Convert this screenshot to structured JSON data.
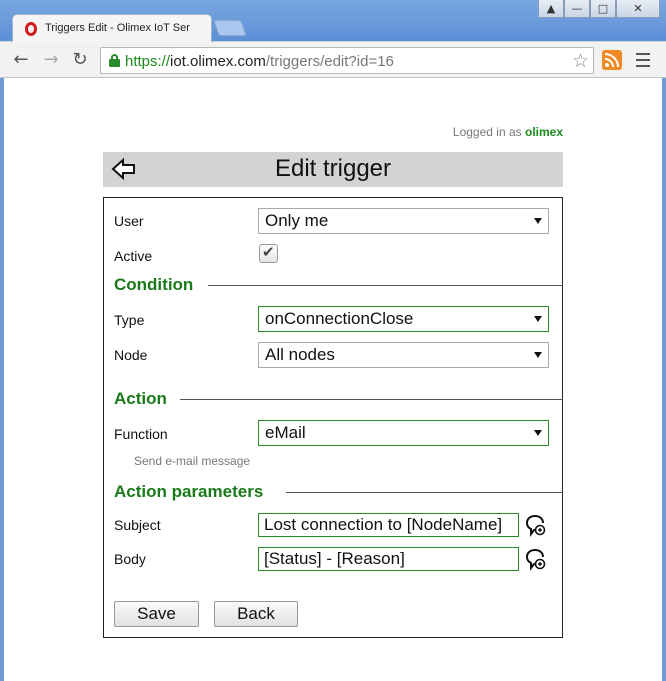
{
  "browser": {
    "tab_title": "Triggers Edit - Olimex IoT Ser",
    "window_buttons": [
      "▲",
      "—",
      "□",
      "✕"
    ],
    "url": {
      "scheme": "https://",
      "host": "iot.olimex.com",
      "path": "/triggers/edit?id=16"
    }
  },
  "session": {
    "prefix": "Logged in as",
    "username": "olimex"
  },
  "page": {
    "title": "Edit trigger"
  },
  "form": {
    "user": {
      "label": "User",
      "value": "Only me"
    },
    "active": {
      "label": "Active",
      "checked": true,
      "check_glyph": "✔"
    },
    "sections": {
      "condition": "Condition",
      "action": "Action",
      "action_parameters": "Action parameters"
    },
    "type": {
      "label": "Type",
      "value": "onConnectionClose"
    },
    "node": {
      "label": "Node",
      "value": "All nodes"
    },
    "function": {
      "label": "Function",
      "value": "eMail",
      "hint": "Send e-mail message"
    },
    "subject": {
      "label": "Subject",
      "value": "Lost connection to [NodeName]"
    },
    "body": {
      "label": "Body",
      "value": "[Status] - [Reason]"
    },
    "buttons": {
      "save": "Save",
      "back": "Back"
    }
  },
  "colors": {
    "accent_green": "#1a7a1a",
    "header_bg": "#d3d3d3",
    "url_scheme": "#1c8a1c"
  }
}
